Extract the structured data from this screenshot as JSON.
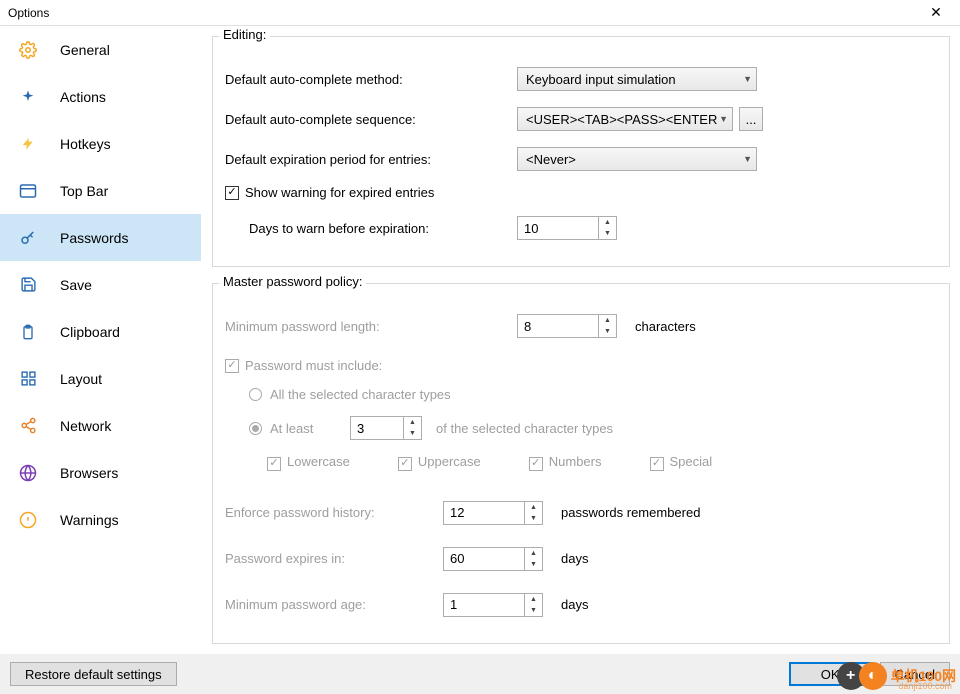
{
  "window": {
    "title": "Options"
  },
  "sidebar": {
    "items": [
      {
        "label": "General"
      },
      {
        "label": "Actions"
      },
      {
        "label": "Hotkeys"
      },
      {
        "label": "Top Bar"
      },
      {
        "label": "Passwords"
      },
      {
        "label": "Save"
      },
      {
        "label": "Clipboard"
      },
      {
        "label": "Layout"
      },
      {
        "label": "Network"
      },
      {
        "label": "Browsers"
      },
      {
        "label": "Warnings"
      }
    ]
  },
  "editing": {
    "legend": "Editing:",
    "method_label": "Default auto-complete method:",
    "method_value": "Keyboard input simulation",
    "sequence_label": "Default auto-complete sequence:",
    "sequence_value": "<USER><TAB><PASS><ENTER",
    "ellipsis": "...",
    "expiration_label": "Default expiration period for entries:",
    "expiration_value": "<Never>",
    "warn_cb": "Show warning for expired entries",
    "days_label": "Days to warn before expiration:",
    "days_value": "10"
  },
  "policy": {
    "legend": "Master password policy:",
    "minlen_label": "Minimum password length:",
    "minlen_value": "8",
    "minlen_unit": "characters",
    "include_label": "Password must include:",
    "all_types": "All the selected character types",
    "at_least": "At least",
    "at_least_value": "3",
    "at_least_suffix": "of the selected character types",
    "lowercase": "Lowercase",
    "uppercase": "Uppercase",
    "numbers": "Numbers",
    "special": "Special",
    "history_label": "Enforce password history:",
    "history_value": "12",
    "history_unit": "passwords remembered",
    "expires_label": "Password expires in:",
    "expires_value": "60",
    "expires_unit": "days",
    "minage_label": "Minimum password age:",
    "minage_value": "1",
    "minage_unit": "days"
  },
  "footer": {
    "restore": "Restore default settings",
    "ok": "OK",
    "cancel": "Cancel"
  },
  "watermark": {
    "brand": "单机100网",
    "url": "danji100.com"
  }
}
